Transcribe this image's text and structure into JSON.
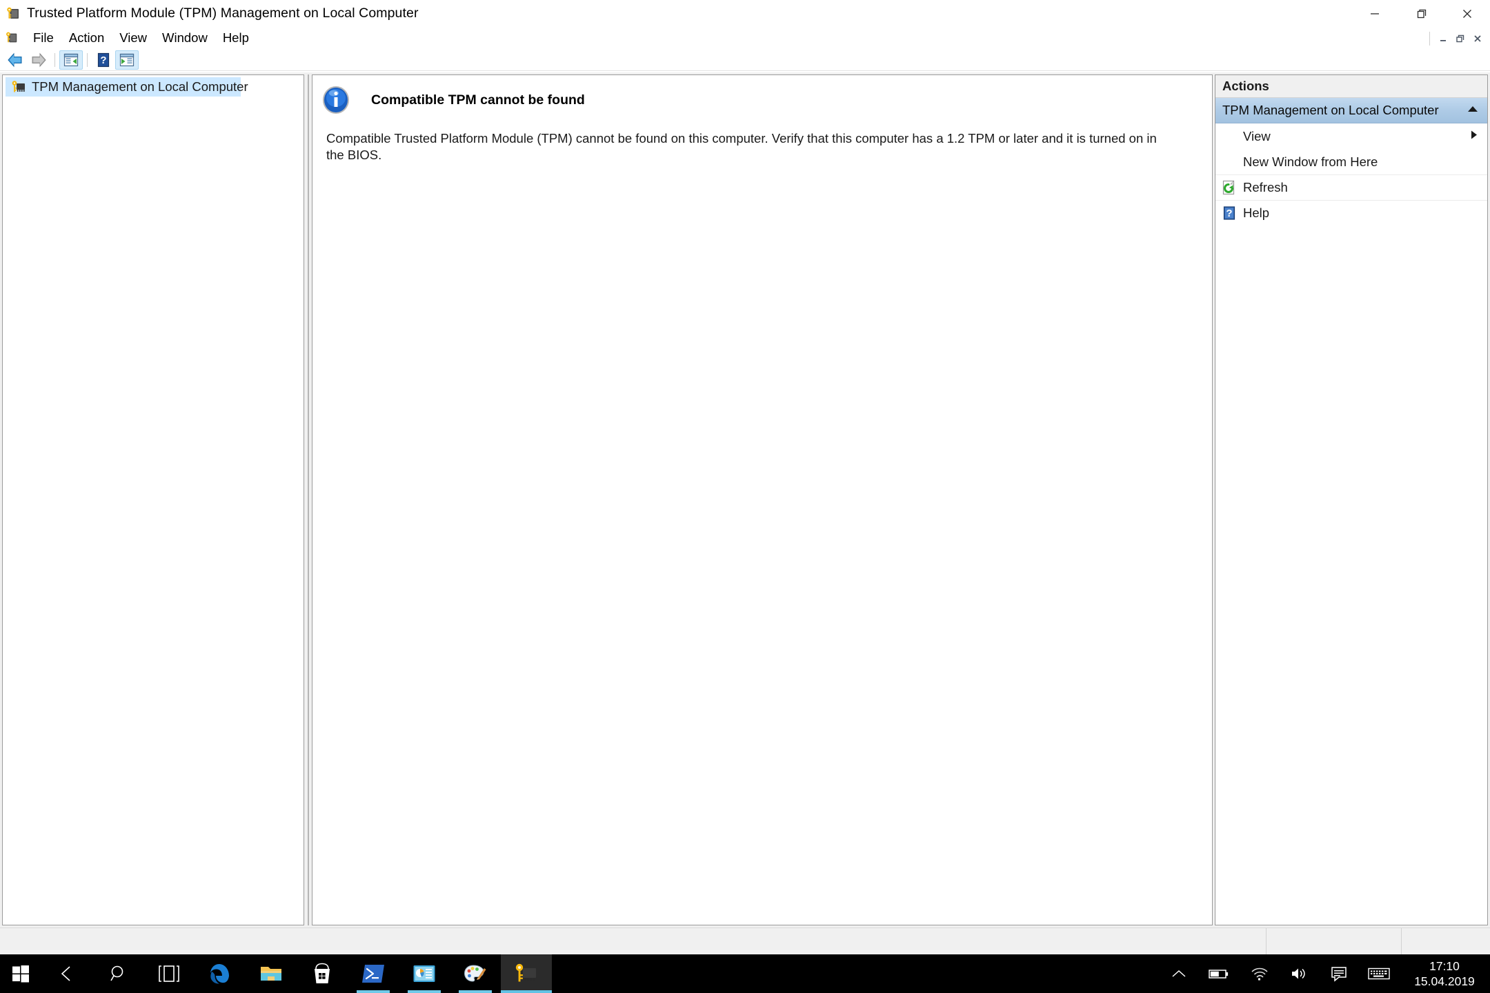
{
  "window": {
    "title": "Trusted Platform Module (TPM) Management on Local Computer",
    "app_icon": "tpm-chip-key-icon",
    "controls": {
      "minimize": "minimize-icon",
      "restore": "restore-icon",
      "close": "close-icon"
    },
    "mdi_controls": {
      "minimize": "–",
      "restore": "❐",
      "close": "✕"
    }
  },
  "menubar": {
    "icon": "console-icon",
    "items": [
      {
        "label": "File"
      },
      {
        "label": "Action"
      },
      {
        "label": "View"
      },
      {
        "label": "Window"
      },
      {
        "label": "Help"
      }
    ]
  },
  "toolbar": {
    "buttons": [
      {
        "name": "back-button",
        "icon": "back-arrow-icon",
        "enabled": true,
        "selected": false
      },
      {
        "name": "forward-button",
        "icon": "forward-arrow-icon",
        "enabled": false,
        "selected": false
      },
      {
        "name": "show-hide-console-tree-button",
        "icon": "console-tree-icon",
        "enabled": true,
        "selected": true
      },
      {
        "name": "help-button",
        "icon": "help-question-icon",
        "enabled": true,
        "selected": false
      },
      {
        "name": "show-hide-action-pane-button",
        "icon": "action-pane-icon",
        "enabled": true,
        "selected": true
      }
    ]
  },
  "tree": {
    "items": [
      {
        "label": "TPM Management on Local Computer",
        "icon": "tpm-chip-key-icon",
        "selected": true
      }
    ]
  },
  "content": {
    "status_icon": "info-icon",
    "heading": "Compatible TPM cannot be found",
    "body": "Compatible Trusted Platform Module (TPM) cannot be found on this computer. Verify that this computer has a 1.2 TPM or later and it is turned on in the BIOS."
  },
  "actions": {
    "header": "Actions",
    "group": {
      "label": "TPM Management on Local Computer",
      "collapse_icon": "chevron-up-icon"
    },
    "items": [
      {
        "label": "View",
        "icon": null,
        "submenu_icon": "chevron-right-icon",
        "divider": false
      },
      {
        "label": "New Window from Here",
        "icon": null,
        "submenu_icon": null,
        "divider": false
      },
      {
        "label": "Refresh",
        "icon": "refresh-icon",
        "submenu_icon": null,
        "divider": true
      },
      {
        "label": "Help",
        "icon": "help-question-icon",
        "submenu_icon": null,
        "divider": true
      }
    ]
  },
  "statusbar": {
    "cells": [
      "",
      "",
      ""
    ]
  },
  "taskbar": {
    "start": "windows-logo-icon",
    "items": [
      {
        "name": "back-button",
        "icon": "back-arrow-icon",
        "running": false,
        "active": false
      },
      {
        "name": "search-button",
        "icon": "search-icon",
        "running": false,
        "active": false
      },
      {
        "name": "task-view-button",
        "icon": "task-view-icon",
        "running": false,
        "active": false
      },
      {
        "name": "edge-button",
        "icon": "edge-icon",
        "running": true,
        "active": false
      },
      {
        "name": "file-explorer-button",
        "icon": "folder-icon",
        "running": false,
        "active": false
      },
      {
        "name": "microsoft-store-button",
        "icon": "store-bag-icon",
        "running": false,
        "active": false
      },
      {
        "name": "powershell-button",
        "icon": "powershell-icon",
        "running": true,
        "active": false
      },
      {
        "name": "computer-management-button",
        "icon": "mmc-console-icon",
        "running": true,
        "active": false
      },
      {
        "name": "paint-button",
        "icon": "paint-palette-icon",
        "running": true,
        "active": false
      },
      {
        "name": "tpm-management-button",
        "icon": "tpm-chip-key-icon",
        "running": true,
        "active": true
      }
    ],
    "tray": [
      {
        "name": "show-hidden-icons-button",
        "icon": "chevron-up-icon"
      },
      {
        "name": "battery-icon",
        "icon": "battery-icon"
      },
      {
        "name": "network-icon",
        "icon": "wifi-icon"
      },
      {
        "name": "volume-icon",
        "icon": "speaker-icon"
      },
      {
        "name": "action-center-icon",
        "icon": "chat-bubble-icon"
      },
      {
        "name": "touch-keyboard-icon",
        "icon": "keyboard-icon"
      }
    ],
    "clock": {
      "time": "17:10",
      "date": "15.04.2019"
    }
  }
}
